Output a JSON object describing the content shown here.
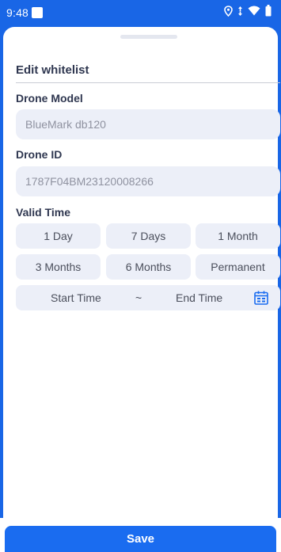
{
  "status_bar": {
    "time": "9:48",
    "icons": [
      "location-icon",
      "data-arrows-icon",
      "wifi-icon",
      "battery-icon"
    ]
  },
  "sheet": {
    "title": "Edit whitelist",
    "drone_model": {
      "label": "Drone Model",
      "value": "BlueMark db120"
    },
    "drone_id": {
      "label": "Drone ID",
      "value": "1787F04BM23120008266"
    },
    "valid_time": {
      "label": "Valid Time",
      "options": [
        "1 Day",
        "7 Days",
        "1 Month",
        "3 Months",
        "6 Months",
        "Permanent"
      ],
      "start_label": "Start Time",
      "separator": "~",
      "end_label": "End Time"
    }
  },
  "actions": {
    "save_label": "Save"
  },
  "colors": {
    "accent": "#1966e6",
    "field_bg": "#eceff8",
    "heading": "#2f3750",
    "placeholder_text": "#8f92a0"
  }
}
